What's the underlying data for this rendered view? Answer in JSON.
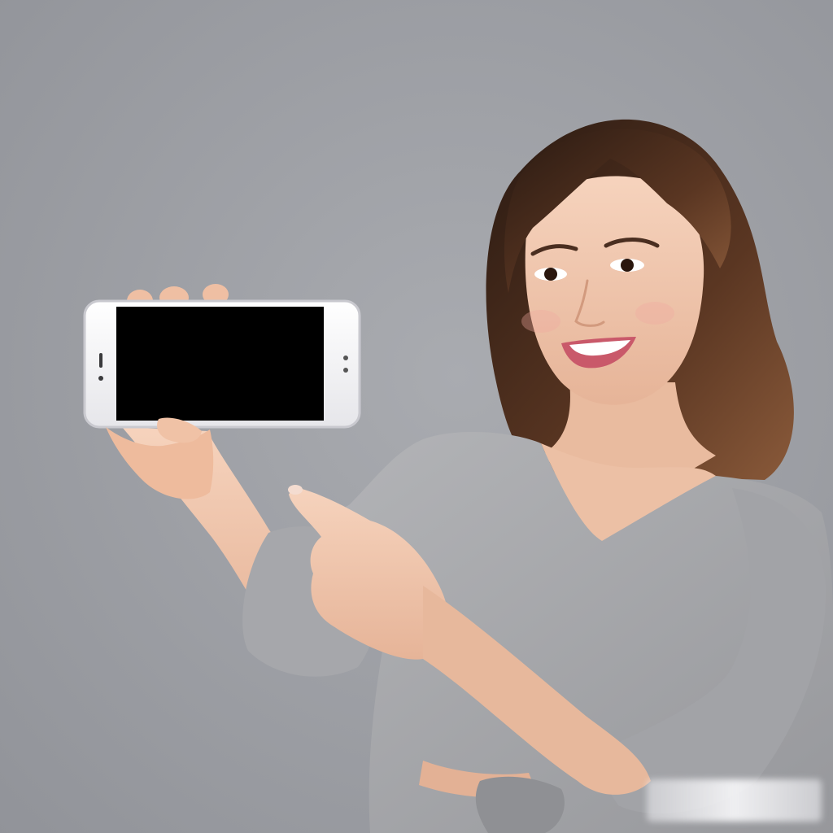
{
  "photo": {
    "colors": {
      "background": "#9b9da3",
      "sweater": "#a9aaad",
      "skin": "#eec3a7",
      "hair": "#3a2418",
      "phone_body": "#f4f4f6",
      "phone_screen": "#000000"
    }
  }
}
